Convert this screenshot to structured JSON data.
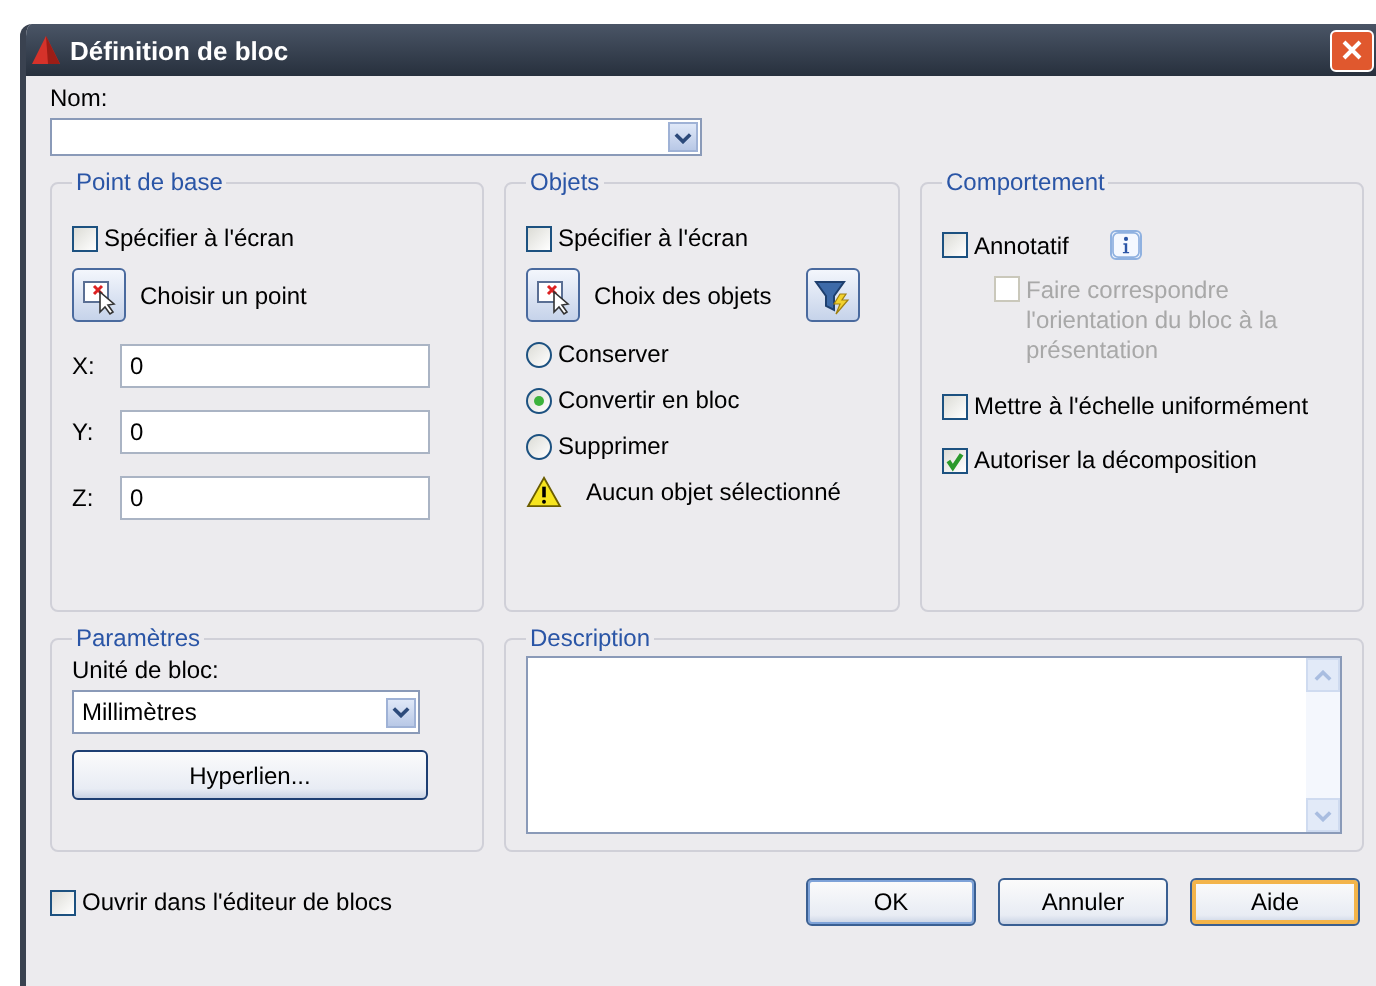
{
  "window": {
    "title": "Définition de bloc"
  },
  "name": {
    "label": "Nom:"
  },
  "base_point": {
    "title": "Point de base",
    "specify_on_screen": {
      "label": "Spécifier à l'écran",
      "checked": false
    },
    "pick_button": "Choisir un point",
    "coords": [
      {
        "label": "X:",
        "value": "0"
      },
      {
        "label": "Y:",
        "value": "0"
      },
      {
        "label": "Z:",
        "value": "0"
      }
    ]
  },
  "objects": {
    "title": "Objets",
    "specify_on_screen": {
      "label": "Spécifier à l'écran",
      "checked": false
    },
    "select_button": "Choix des objets",
    "options": [
      {
        "label": "Conserver",
        "selected": false
      },
      {
        "label": "Convertir en bloc",
        "selected": true
      },
      {
        "label": "Supprimer",
        "selected": false
      }
    ],
    "warning": "Aucun objet sélectionné"
  },
  "behavior": {
    "title": "Comportement",
    "options": [
      {
        "label": "Annotatif",
        "checked": false,
        "disabled": false,
        "info": true,
        "children": [
          {
            "label": "Faire correspondre l'orientation du bloc à la présentation",
            "checked": false,
            "disabled": true
          }
        ]
      },
      {
        "label": "Mettre à l'échelle uniformément",
        "checked": false,
        "disabled": false
      },
      {
        "label": "Autoriser la décomposition",
        "checked": true,
        "disabled": false
      }
    ]
  },
  "settings": {
    "title": "Paramètres",
    "unit_label": "Unité de bloc:",
    "unit_value": "Millimètres",
    "hyperlink_button": "Hyperlien..."
  },
  "description": {
    "title": "Description"
  },
  "open_in_editor": {
    "label": "Ouvrir dans l'éditeur de blocs",
    "checked": false
  },
  "buttons": [
    {
      "label": "OK",
      "kind": "default"
    },
    {
      "label": "Annuler",
      "kind": "normal"
    },
    {
      "label": "Aide",
      "kind": "focused"
    }
  ]
}
